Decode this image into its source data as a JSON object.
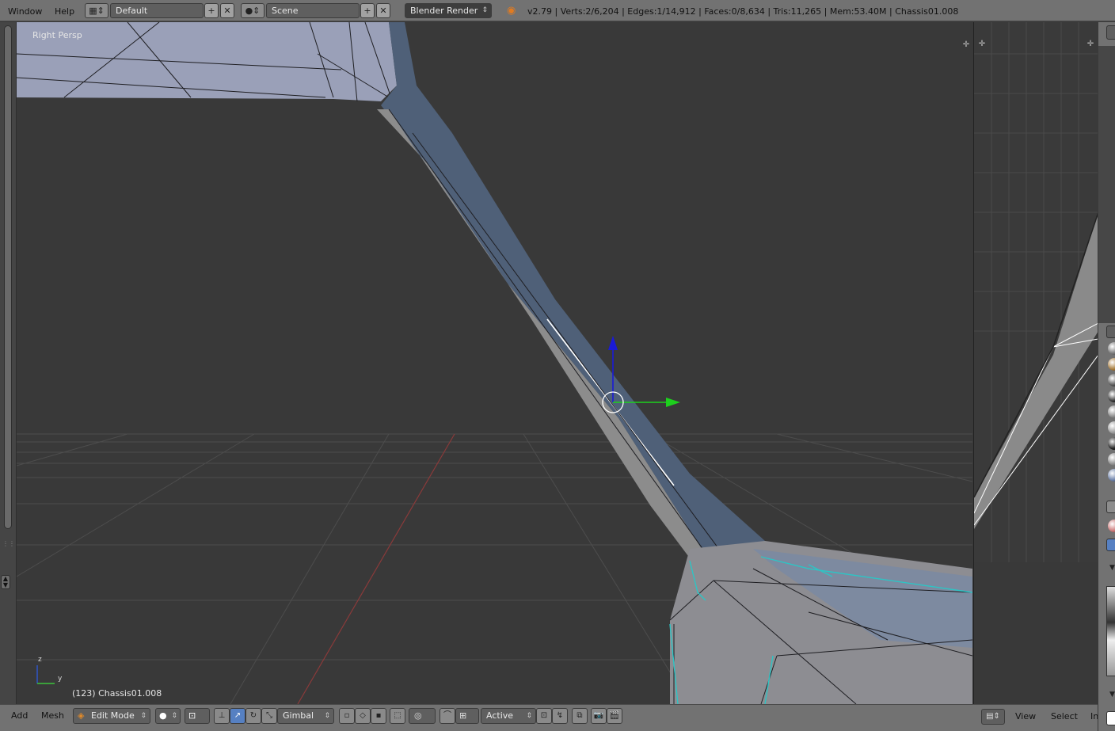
{
  "topbar": {
    "menu_window": "Window",
    "menu_help": "Help",
    "screen_layout": "Default",
    "scene": "Scene",
    "render_engine": "Blender Render",
    "status": "v2.79 | Verts:2/6,204 | Edges:1/14,912 | Faces:0/8,634 | Tris:11,265 | Mem:53.40M | Chassis01.008"
  },
  "viewport": {
    "view_label": "Right Persp",
    "object_label": "(123) Chassis01.008",
    "axis_z": "z",
    "axis_y": "y"
  },
  "bottombar": {
    "menu_add": "Add",
    "menu_mesh": "Mesh",
    "mode": "Edit Mode",
    "orientation": "Gimbal",
    "pivot": "Active"
  },
  "rightpanel": {
    "menu_view": "View",
    "menu_select": "Select",
    "menu_image_cut": "In"
  },
  "colors": {
    "header": "#727272",
    "viewport_bg": "#393939",
    "mesh_fill": "#8a8f9e",
    "highlight": "#2ec4c4",
    "manip_z": "#1a1ad8",
    "manip_y": "#1dd01d"
  }
}
